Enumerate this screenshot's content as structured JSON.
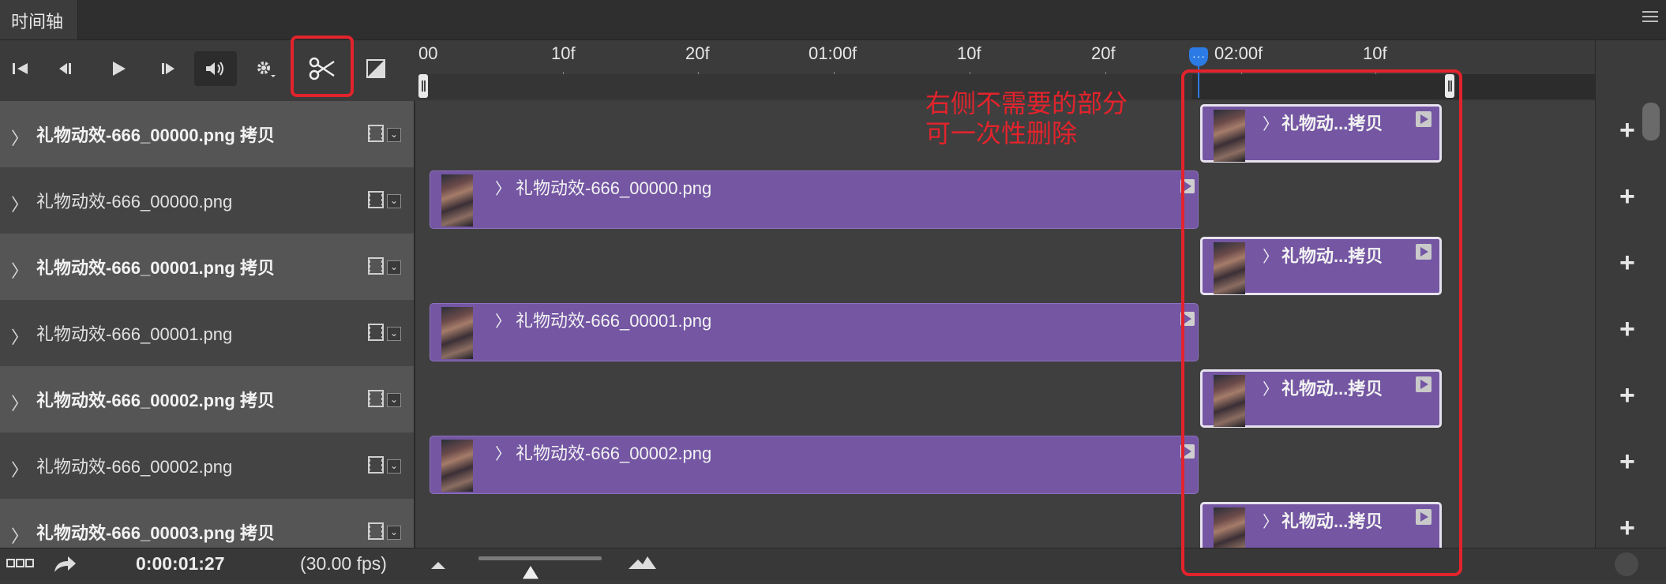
{
  "panel": {
    "tab_label": "时间轴"
  },
  "ruler": {
    "labels": [
      "00",
      "10f",
      "20f",
      "01:00f",
      "10f",
      "20f",
      "02:00f",
      "10f"
    ]
  },
  "layers": [
    {
      "name": "礼物动效-666_00000.png 拷贝",
      "kind": "copy",
      "clip_label": "礼物动...拷贝"
    },
    {
      "name": "礼物动效-666_00000.png",
      "kind": "orig",
      "clip_label": "礼物动效-666_00000.png"
    },
    {
      "name": "礼物动效-666_00001.png 拷贝",
      "kind": "copy",
      "clip_label": "礼物动...拷贝"
    },
    {
      "name": "礼物动效-666_00001.png",
      "kind": "orig",
      "clip_label": "礼物动效-666_00001.png"
    },
    {
      "name": "礼物动效-666_00002.png 拷贝",
      "kind": "copy",
      "clip_label": "礼物动...拷贝"
    },
    {
      "name": "礼物动效-666_00002.png",
      "kind": "orig",
      "clip_label": "礼物动效-666_00002.png"
    },
    {
      "name": "礼物动效-666_00003.png 拷贝",
      "kind": "copy",
      "clip_label": "礼物动...拷贝"
    }
  ],
  "status": {
    "timecode": "0:00:01:27",
    "fps": "(30.00 fps)"
  },
  "annotation": {
    "line1": "右侧不需要的部分",
    "line2": "可一次性删除"
  },
  "colors": {
    "clip": "#7456a3",
    "highlight": "#e3232c",
    "playhead": "#2c7be5"
  }
}
